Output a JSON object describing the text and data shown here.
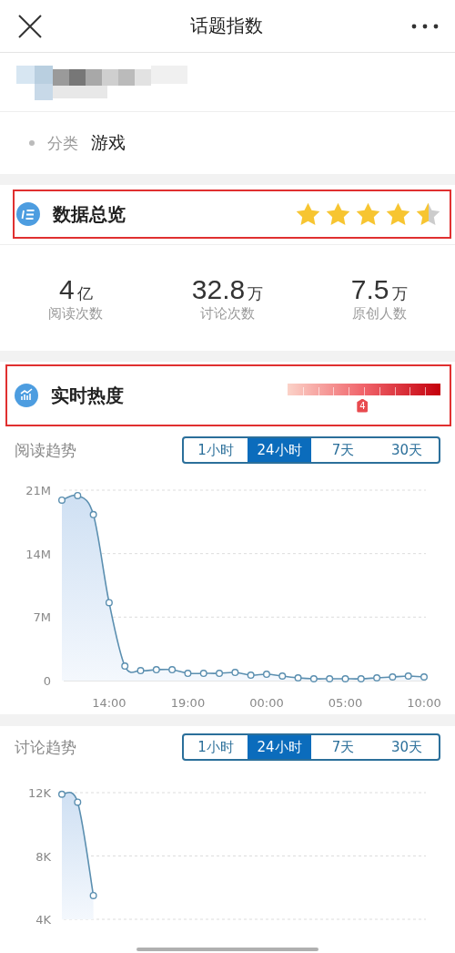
{
  "header": {
    "title": "话题指数"
  },
  "category": {
    "label": "分类",
    "value": "游戏"
  },
  "overview": {
    "title": "数据总览",
    "highlighted": true,
    "stars": 4.5
  },
  "stats": [
    {
      "value": "4",
      "unit": "亿",
      "label": "阅读次数"
    },
    {
      "value": "32.8",
      "unit": "万",
      "label": "讨论次数"
    },
    {
      "value": "7.5",
      "unit": "万",
      "label": "原创人数"
    }
  ],
  "heat": {
    "title": "实时热度",
    "highlighted": true,
    "level": 0.49,
    "marker": "4"
  },
  "trends": [
    {
      "title": "阅读趋势",
      "ranges": [
        {
          "label": "1小时",
          "selected": false
        },
        {
          "label": "24小时",
          "selected": true
        },
        {
          "label": "7天",
          "selected": false
        },
        {
          "label": "30天",
          "selected": false
        }
      ],
      "chart_data": {
        "type": "area",
        "categories": [
          null,
          null,
          null,
          "14:00",
          null,
          null,
          null,
          null,
          "19:00",
          null,
          null,
          null,
          null,
          "00:00",
          null,
          null,
          null,
          null,
          "05:00",
          null,
          null,
          null,
          null,
          "10:00"
        ],
        "ylim": [
          0,
          21
        ],
        "yticks": [
          {
            "value": 0,
            "label": "0"
          },
          {
            "value": 7,
            "label": "7M"
          },
          {
            "value": 14,
            "label": "14M"
          },
          {
            "value": 21,
            "label": "21M"
          }
        ],
        "series": [
          {
            "color": "#5b8fb0",
            "values": [
              19.9,
              20.4,
              18.3,
              8.6,
              1.6,
              1.1,
              1.2,
              1.2,
              0.8,
              0.8,
              0.8,
              0.9,
              0.6,
              0.7,
              0.5,
              0.3,
              0.2,
              0.2,
              0.2,
              0.2,
              0.3,
              0.4,
              0.5,
              0.4
            ]
          }
        ]
      }
    },
    {
      "title": "讨论趋势",
      "ranges": [
        {
          "label": "1小时",
          "selected": false
        },
        {
          "label": "24小时",
          "selected": true
        },
        {
          "label": "7天",
          "selected": false
        },
        {
          "label": "30天",
          "selected": false
        }
      ],
      "chart_data": {
        "type": "area",
        "categories": [
          null,
          null,
          null,
          null,
          null,
          null,
          null,
          null,
          null,
          null,
          null,
          null,
          null,
          null,
          null,
          null,
          null,
          null,
          null,
          null,
          null,
          null,
          null,
          null
        ],
        "ylim": [
          4,
          12
        ],
        "yticks": [
          {
            "value": 4,
            "label": "4K"
          },
          {
            "value": 8,
            "label": "8K"
          },
          {
            "value": 12,
            "label": "12K"
          }
        ],
        "series": [
          {
            "color": "#5b8fb0",
            "values": [
              11.9,
              11.4,
              5.5,
              null,
              null,
              null,
              null,
              null,
              null,
              null,
              null,
              null,
              null,
              null,
              null,
              null,
              null,
              null,
              null,
              null,
              null,
              null,
              null,
              null
            ]
          }
        ]
      }
    }
  ]
}
